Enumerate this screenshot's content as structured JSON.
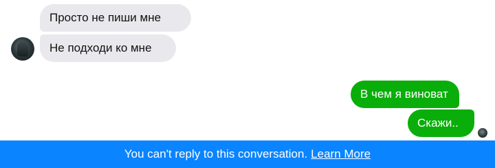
{
  "conversation": {
    "incoming": [
      {
        "text": "Просто не пиши мне"
      },
      {
        "text": "Не подходи ко мне"
      }
    ],
    "outgoing": [
      {
        "text": "В чем я виноват"
      },
      {
        "text": "Скажи.."
      }
    ]
  },
  "footer": {
    "message": "You can't reply to this conversation.",
    "link_label": "Learn More"
  },
  "colors": {
    "incoming_bubble": "#e9e9ed",
    "outgoing_bubble": "#0aae0a",
    "footer_bar": "#0a84ff"
  },
  "icons": {
    "contact_avatar": "avatar-icon",
    "seen_indicator": "read-receipt-avatar-icon"
  }
}
